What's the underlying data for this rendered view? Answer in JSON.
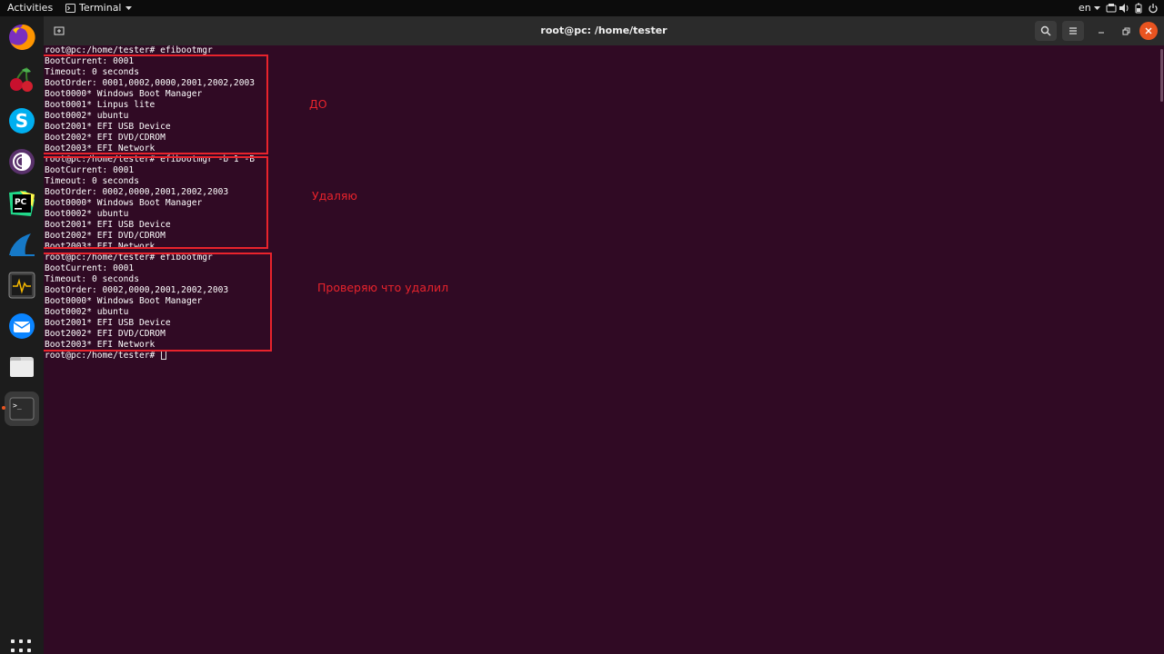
{
  "topbar": {
    "activities": "Activities",
    "app_name": "Terminal",
    "language": "en",
    "icons": [
      "terminal-app-icon",
      "chevron-down-icon",
      "network-icon",
      "volume-icon",
      "battery-icon",
      "power-icon"
    ]
  },
  "dock": {
    "items": [
      "firefox",
      "cherry",
      "skype",
      "tor-browser",
      "pycharm",
      "wireshark",
      "system-monitor",
      "thunderbird",
      "files",
      "terminal"
    ],
    "active": "terminal",
    "apps_grid": "show-applications"
  },
  "window": {
    "title": "root@pc: /home/tester",
    "colors": {
      "background": "#300a24",
      "titlebar": "#2b2b2b",
      "close": "#e95420",
      "annotation": "#e8232c"
    }
  },
  "terminal": {
    "lines": [
      "root@pc:/home/tester# efibootmgr",
      "BootCurrent: 0001",
      "Timeout: 0 seconds",
      "BootOrder: 0001,0002,0000,2001,2002,2003",
      "Boot0000* Windows Boot Manager",
      "Boot0001* Linpus lite",
      "Boot0002* ubuntu",
      "Boot2001* EFI USB Device",
      "Boot2002* EFI DVD/CDROM",
      "Boot2003* EFI Network",
      "root@pc:/home/tester# efibootmgr -b 1 -B",
      "BootCurrent: 0001",
      "Timeout: 0 seconds",
      "BootOrder: 0002,0000,2001,2002,2003",
      "Boot0000* Windows Boot Manager",
      "Boot0002* ubuntu",
      "Boot2001* EFI USB Device",
      "Boot2002* EFI DVD/CDROM",
      "Boot2003* EFI Network",
      "root@pc:/home/tester# efibootmgr",
      "BootCurrent: 0001",
      "Timeout: 0 seconds",
      "BootOrder: 0002,0000,2001,2002,2003",
      "Boot0000* Windows Boot Manager",
      "Boot0002* ubuntu",
      "Boot2001* EFI USB Device",
      "Boot2002* EFI DVD/CDROM",
      "Boot2003* EFI Network"
    ],
    "prompt": "root@pc:/home/tester# "
  },
  "annotations": {
    "before": "ДО",
    "deleting": "Удаляю",
    "verify": "Проверяю  что удалил"
  }
}
